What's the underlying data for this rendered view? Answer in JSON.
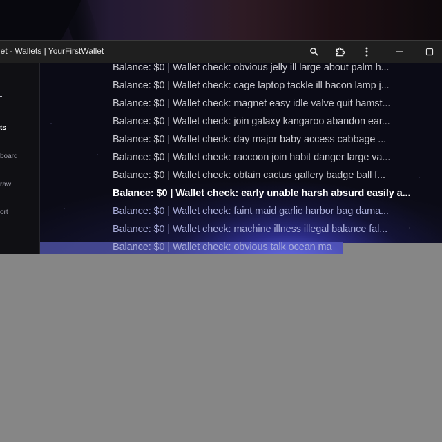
{
  "window": {
    "title": "let - Wallets | YourFirstWallet",
    "controls": {
      "zoom_icon": "magnifier-icon",
      "extensions_icon": "puzzle-icon",
      "menu_icon": "kebab-menu-icon",
      "minimize_icon": "minimize-icon",
      "maximize_icon": "maximize-icon"
    }
  },
  "sidebar": {
    "items": [
      {
        "label": "ts",
        "active": true
      },
      {
        "label": "board",
        "active": false
      },
      {
        "label": "raw",
        "active": false
      },
      {
        "label": "ort",
        "active": false
      }
    ]
  },
  "wallets": [
    {
      "text": "Balance: $0 | Wallet check: obvious jelly ill large about palm h..."
    },
    {
      "text": "Balance: $0 | Wallet check: cage laptop tackle ill bacon lamp j..."
    },
    {
      "text": "Balance: $0 | Wallet check: magnet easy idle valve quit hamst..."
    },
    {
      "text": "Balance: $0 | Wallet check: join galaxy kangaroo abandon ear..."
    },
    {
      "text": "Balance: $0 | Wallet check: day major baby access cabbage ..."
    },
    {
      "text": "Balance: $0 | Wallet check: raccoon join habit danger large va..."
    },
    {
      "text": "Balance: $0 | Wallet check: obtain cactus gallery badge ball f..."
    },
    {
      "text": "Balance: $0 | Wallet check: early unable harsh absurd easily a..."
    },
    {
      "text": "Balance: $0 | Wallet check: faint maid garlic harbor bag dama..."
    },
    {
      "text": "Balance: $0 | Wallet check: machine illness illegal balance fal..."
    },
    {
      "text": "Balance: $0 | Wallet check: obvious talk ocean ma"
    }
  ],
  "colors": {
    "accent": "#5a5ed0",
    "titlebar": "#1f1f1f",
    "background": "#0b0b16"
  }
}
